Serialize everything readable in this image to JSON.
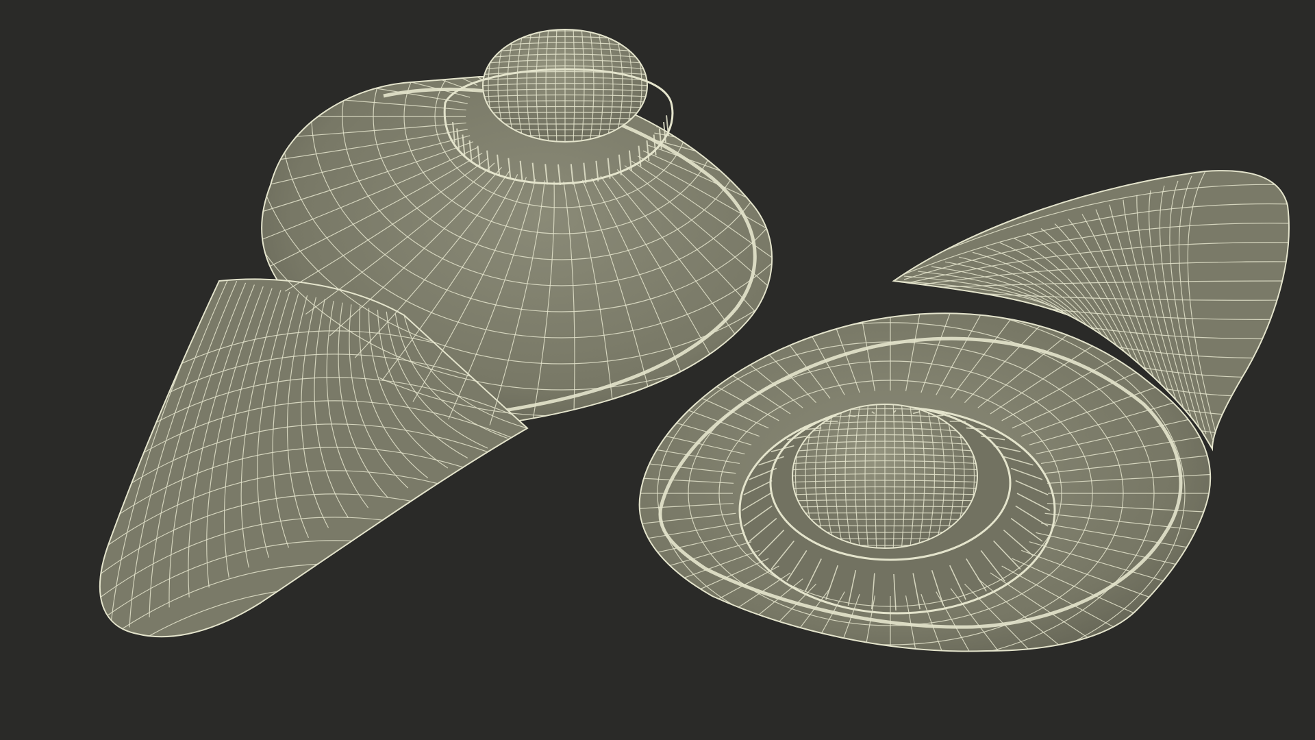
{
  "scene": {
    "background": "#2a2a28",
    "surface_fill": "#7b7b69",
    "surface_shadow": "#5f5f51",
    "surface_highlight": "#8d8d79",
    "wire_color": "#e4e4cc",
    "objects": [
      {
        "name": "wireframe-mouse-left",
        "view": "rear-three-quarter"
      },
      {
        "name": "wireframe-mouse-right",
        "view": "top-three-quarter"
      }
    ]
  }
}
